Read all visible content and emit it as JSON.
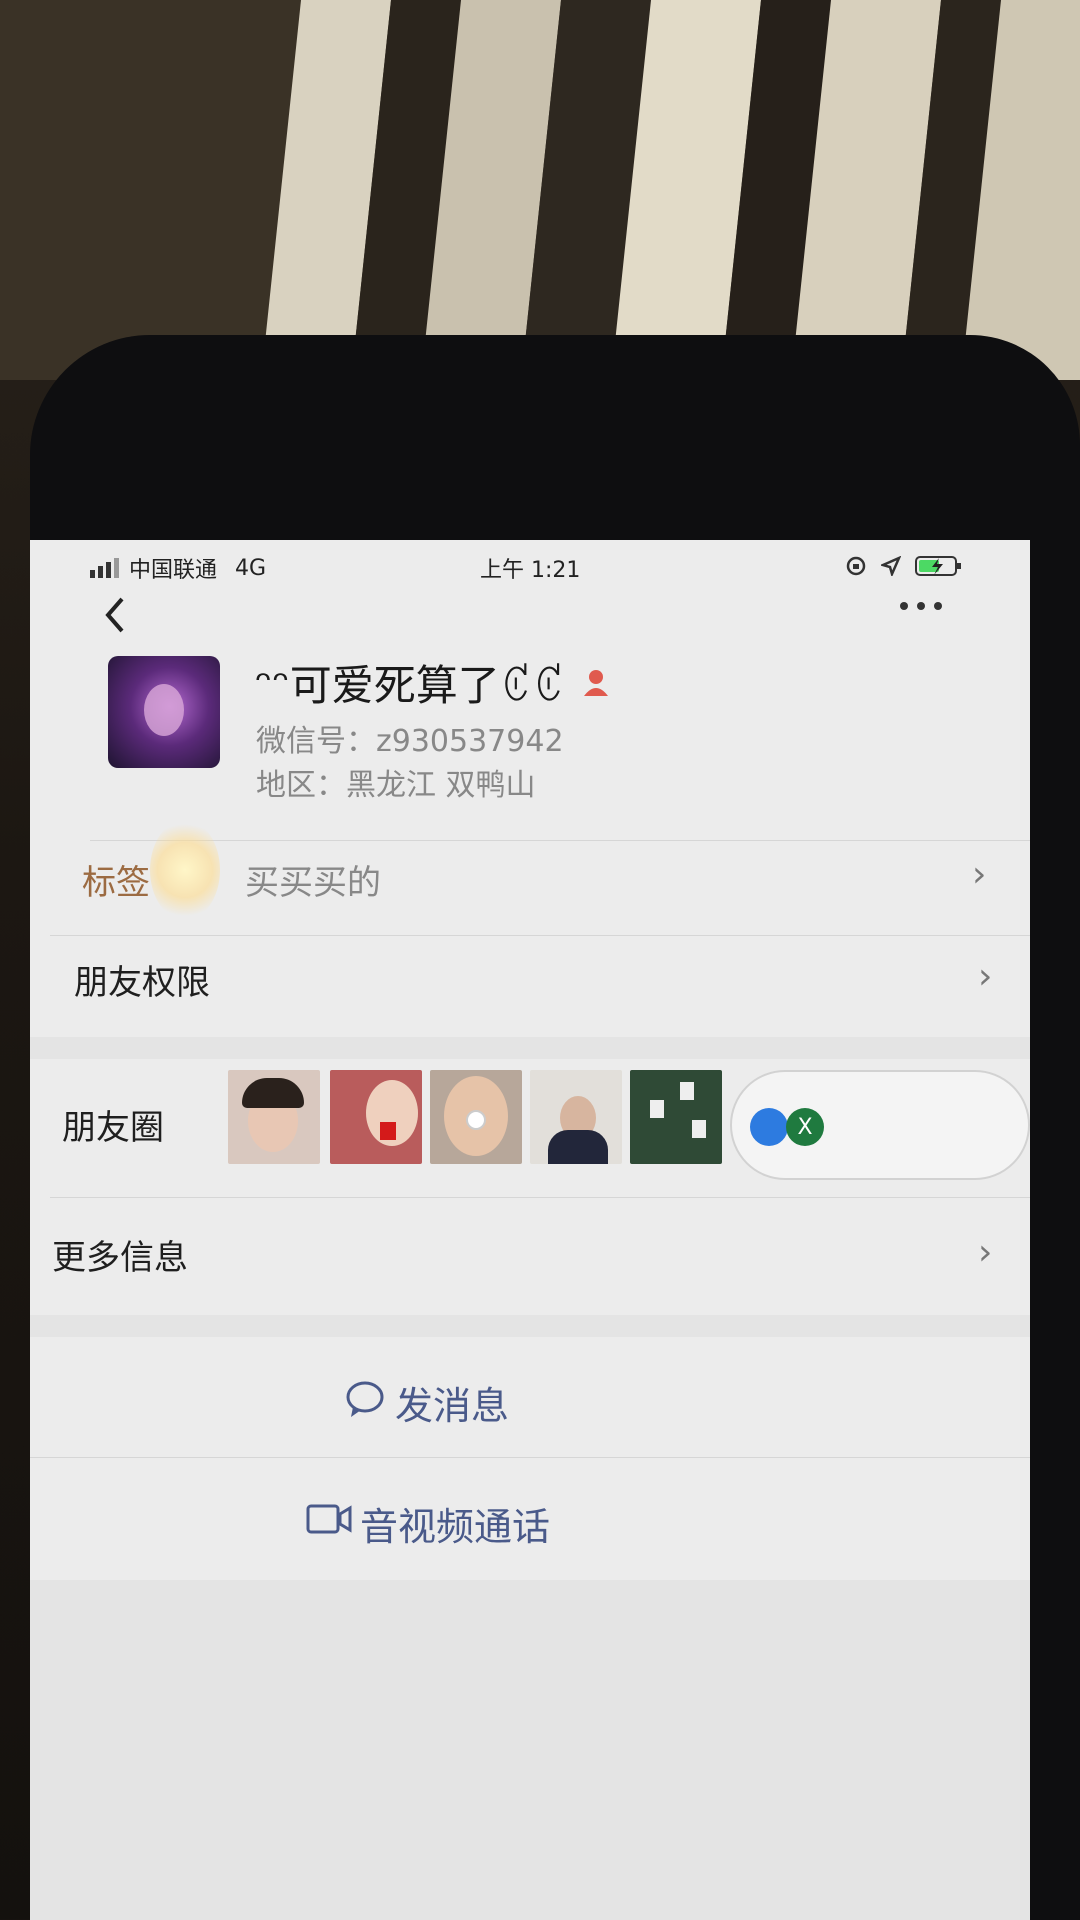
{
  "status_bar": {
    "carrier": "中国联通",
    "network": "4G",
    "time": "上午 1:21"
  },
  "nav": {
    "back_icon": "chevron-left-icon",
    "more_icon": "ellipsis-icon"
  },
  "profile": {
    "nickname": "ᵔᵔ可爱死算了ꊐꊐ",
    "wechat_id": "微信号：z930537942",
    "region": "地区：黑龙江 双鸭山",
    "gender_icon": "female-icon",
    "gender_color": "#e05a4e"
  },
  "rows": {
    "tags_label": "标签",
    "tags_value": "买买买的",
    "permissions_label": "朋友权限",
    "moments_label": "朋友圈",
    "more_info_label": "更多信息"
  },
  "overlay": {
    "close_badge": "X"
  },
  "actions": {
    "send_message": "发消息",
    "video_call": "音视频通话",
    "accent_color": "#4a5a8a"
  }
}
